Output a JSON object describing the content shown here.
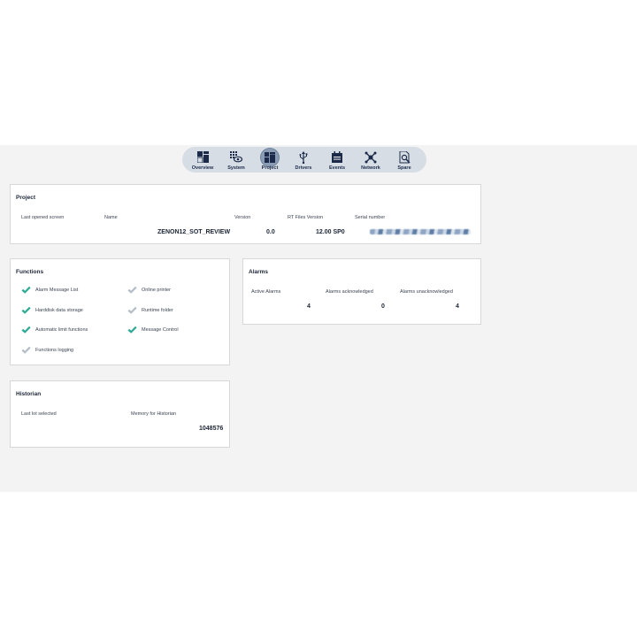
{
  "nav": {
    "items": [
      {
        "label": "Overview",
        "icon": "overview-icon",
        "active": false
      },
      {
        "label": "System",
        "icon": "system-icon",
        "active": false
      },
      {
        "label": "Project",
        "icon": "project-icon",
        "active": true
      },
      {
        "label": "Drivers",
        "icon": "usb-icon",
        "active": false
      },
      {
        "label": "Events",
        "icon": "calendar-icon",
        "active": false
      },
      {
        "label": "Network",
        "icon": "network-icon",
        "active": false
      },
      {
        "label": "Spare",
        "icon": "spare-icon",
        "active": false
      }
    ]
  },
  "project": {
    "title": "Project",
    "last_opened_label": "Last opened screen",
    "name_label": "Name",
    "name_value": "ZENON12_SOT_REVIEW",
    "version_label": "Version",
    "version_value": "0.0",
    "rt_files_label": "RT Files Version",
    "rt_files_value": "12.00 SP0",
    "serial_label": "Serial number"
  },
  "functions": {
    "title": "Functions",
    "items": [
      {
        "label": "Alarm Message List",
        "enabled": true
      },
      {
        "label": "Online printer",
        "enabled": false
      },
      {
        "label": "Harddisk data storage",
        "enabled": true
      },
      {
        "label": "Runtime folder",
        "enabled": false
      },
      {
        "label": "Automatic limit functions",
        "enabled": true
      },
      {
        "label": "Message Control",
        "enabled": true
      },
      {
        "label": "Functions logging",
        "enabled": false
      }
    ]
  },
  "alarms": {
    "title": "Alarms",
    "active_label": "Active Alarms",
    "active_value": "4",
    "ack_label": "Alarms acknowledged",
    "ack_value": "0",
    "unack_label": "Alarms unacknowledged",
    "unack_value": "4"
  },
  "historian": {
    "title": "Historian",
    "last_lot_label": "Last lot selected",
    "memory_label": "Memory for Historian",
    "memory_value": "1048576"
  },
  "colors": {
    "check_enabled": "#2bab94",
    "check_disabled": "#b4bcc6",
    "nav_bg": "#d6dde4",
    "nav_active": "#8a9db5",
    "icon": "#1c2a4a"
  }
}
